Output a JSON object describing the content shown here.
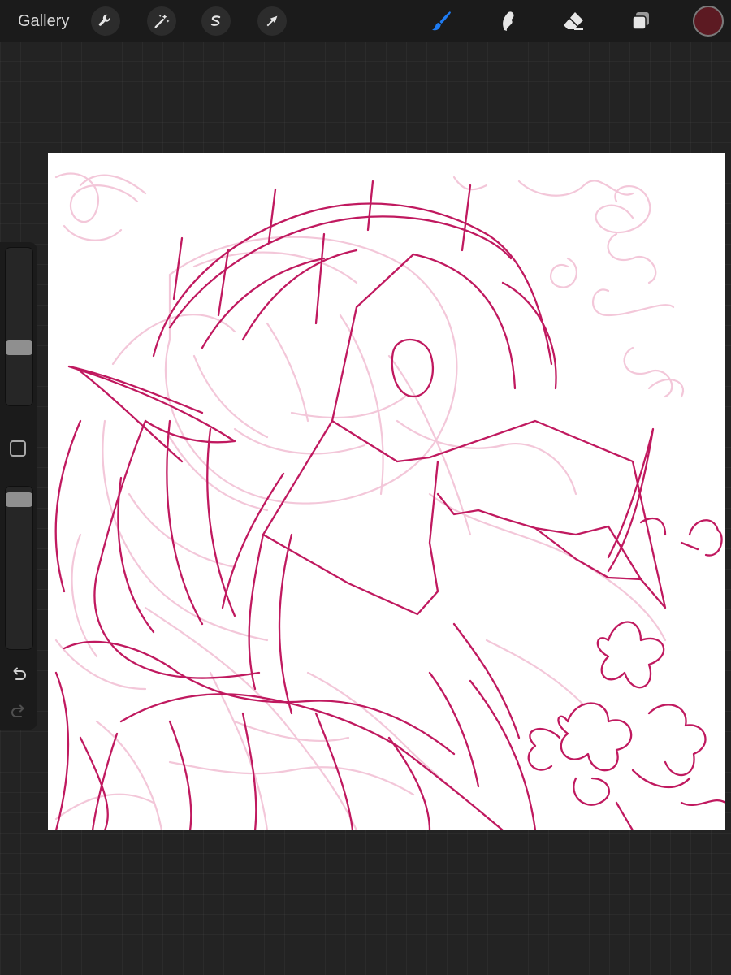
{
  "toolbar": {
    "gallery_label": "Gallery",
    "left_tools": [
      "wrench-icon",
      "magic-wand-icon",
      "selection-icon",
      "transform-arrow-icon"
    ],
    "right_tools": [
      "brush-icon",
      "smudge-icon",
      "eraser-icon",
      "layers-icon"
    ],
    "active_tool": "brush-icon",
    "active_color": "#5c1a22",
    "accent_color": "#1e7bf2"
  },
  "sidebar": {
    "brush_size": 0.35,
    "brush_opacity": 0.96,
    "icons": [
      "undo-icon",
      "redo-icon"
    ]
  },
  "canvas": {
    "background": "#ffffff",
    "sketch_color": "#c0195f",
    "underlay_color": "#f2c1d5"
  }
}
